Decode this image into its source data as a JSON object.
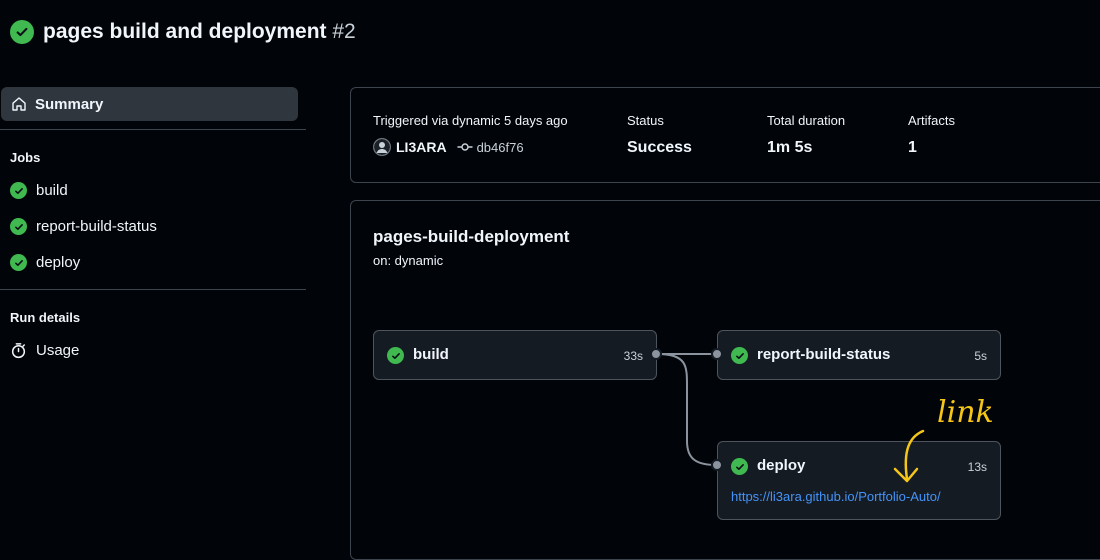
{
  "header": {
    "title": "pages build and deployment",
    "run_number": "#2",
    "status_icon": "check-circle-fill-icon",
    "success_color": "#3fb950"
  },
  "sidebar": {
    "summary_label": "Summary",
    "jobs_heading": "Jobs",
    "jobs": [
      {
        "label": "build"
      },
      {
        "label": "report-build-status"
      },
      {
        "label": "deploy"
      }
    ],
    "run_details_heading": "Run details",
    "usage_label": "Usage"
  },
  "summary": {
    "triggered_label": "Triggered via dynamic 5 days ago",
    "actor": "LI3ARA",
    "commit_sha": "db46f76",
    "status_label": "Status",
    "status_value": "Success",
    "duration_label": "Total duration",
    "duration_value": "1m 5s",
    "artifacts_label": "Artifacts",
    "artifacts_value": "1"
  },
  "workflow": {
    "name": "pages-build-deployment",
    "trigger": "on: dynamic",
    "jobs": {
      "build": {
        "name": "build",
        "duration": "33s"
      },
      "report": {
        "name": "report-build-status",
        "duration": "5s"
      },
      "deploy": {
        "name": "deploy",
        "duration": "13s",
        "link": "https://li3ara.github.io/Portfolio-Auto/"
      }
    }
  },
  "annotation": {
    "text": "link",
    "color": "#f5c518"
  },
  "colors": {
    "background": "#010409",
    "card_border": "#3d444d",
    "job_box": "#151b23",
    "link": "#4493f8",
    "sidebar_active": "#30363d"
  }
}
